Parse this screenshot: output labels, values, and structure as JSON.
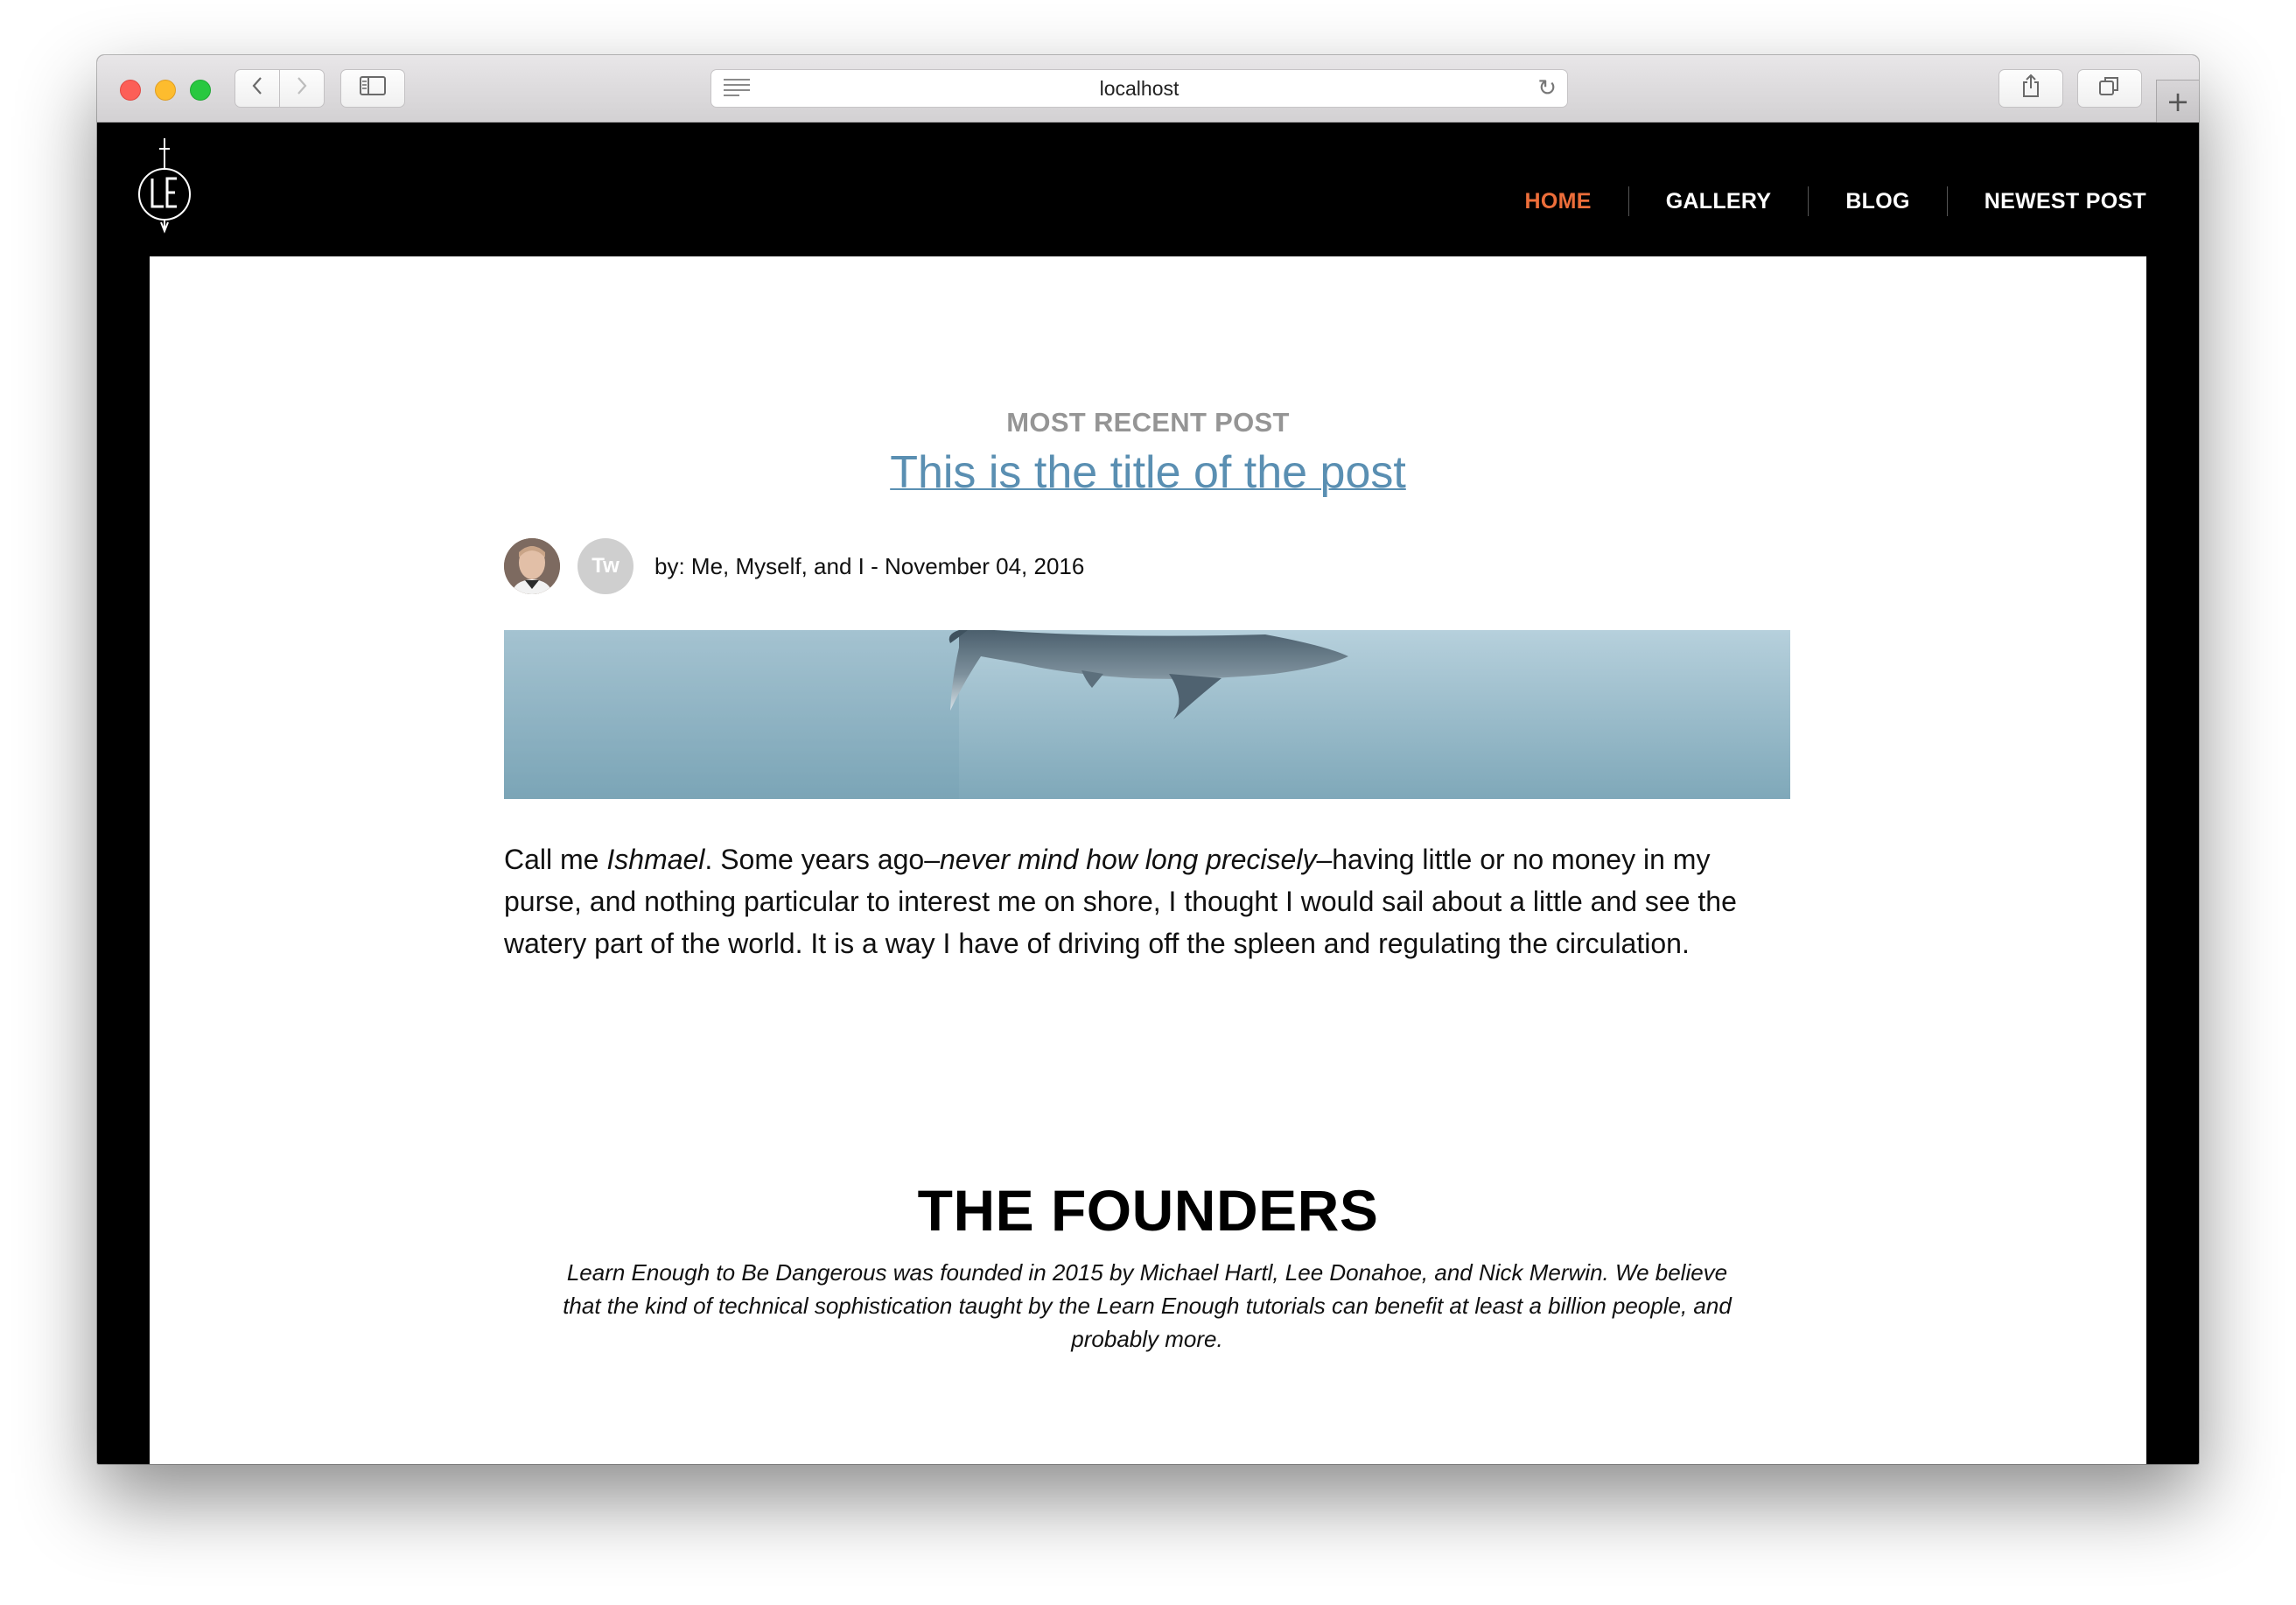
{
  "browser": {
    "url": "localhost",
    "icons": [
      "back-icon",
      "forward-icon",
      "sidebar-icon",
      "reader-icon",
      "reload-icon",
      "share-icon",
      "tabs-icon",
      "new-tab-icon"
    ]
  },
  "site": {
    "logo_text": "LE",
    "nav": [
      {
        "label": "HOME",
        "active": true
      },
      {
        "label": "GALLERY",
        "active": false
      },
      {
        "label": "BLOG",
        "active": false
      },
      {
        "label": "NEWEST POST",
        "active": false
      }
    ],
    "accent_color": "#ed6e3a",
    "link_color": "#5a8fb2"
  },
  "post": {
    "kicker": "MOST RECENT POST",
    "title": "This is the title of the post",
    "author_badge": "Tw",
    "byline": "by: Me, Myself, and I - November 04, 2016",
    "body_intro": "Call me ",
    "body_name": "Ishmael",
    "body_mid": ". Some years ago–",
    "body_italic": "never mind how long precisely",
    "body_rest": "–having little or no money in my purse, and nothing particular to interest me on shore, I thought I would sail about a little and see the watery part of the world. It is a way I have of driving off the spleen and regulating the circulation."
  },
  "founders": {
    "heading": "THE FOUNDERS",
    "text": "Learn Enough to Be Dangerous was founded in 2015 by Michael Hartl, Lee Donahoe, and Nick Merwin. We believe that the kind of technical sophistication taught by the Learn Enough tutorials can benefit at least a billion people, and probably more."
  }
}
